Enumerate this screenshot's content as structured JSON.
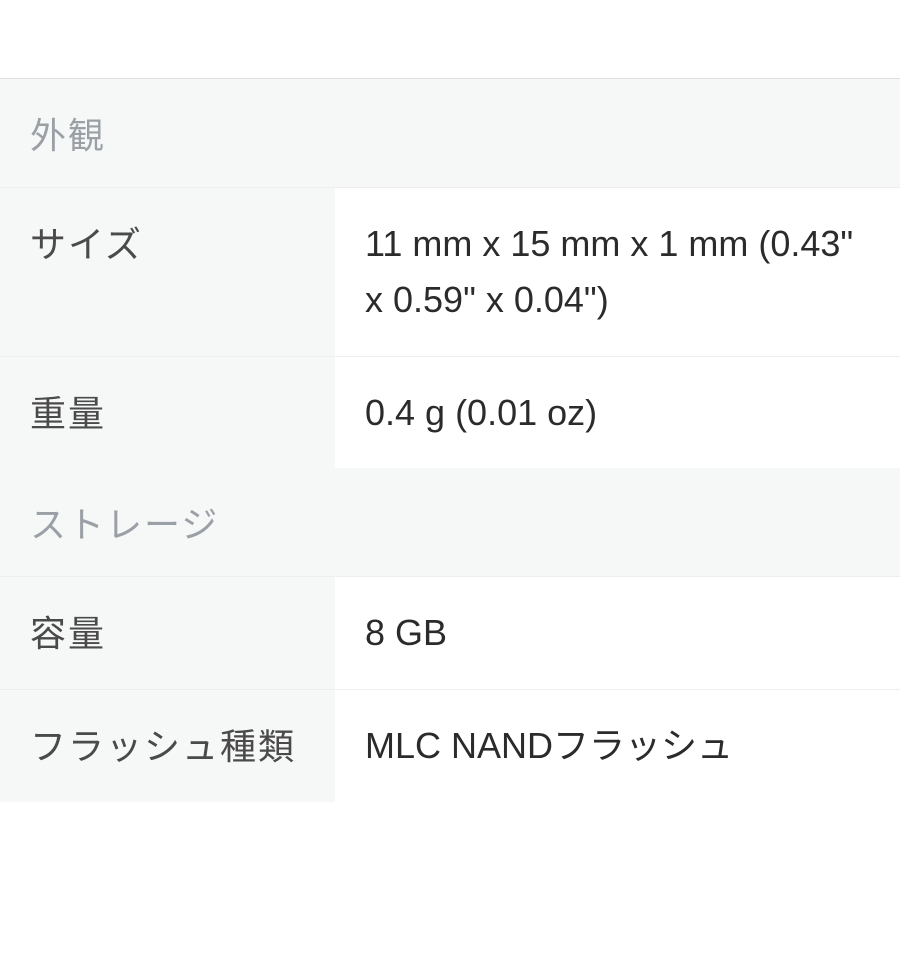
{
  "sections": [
    {
      "header": "外観",
      "rows": [
        {
          "label": "サイズ",
          "value": "11 mm x 15 mm x 1 mm (0.43\" x 0.59\" x 0.04\")"
        },
        {
          "label": "重量",
          "value": "0.4 g (0.01 oz)"
        }
      ]
    },
    {
      "header": "ストレージ",
      "rows": [
        {
          "label": "容量",
          "value": "8 GB"
        },
        {
          "label": "フラッシュ種類",
          "value": "MLC NANDフラッシュ"
        }
      ]
    }
  ]
}
